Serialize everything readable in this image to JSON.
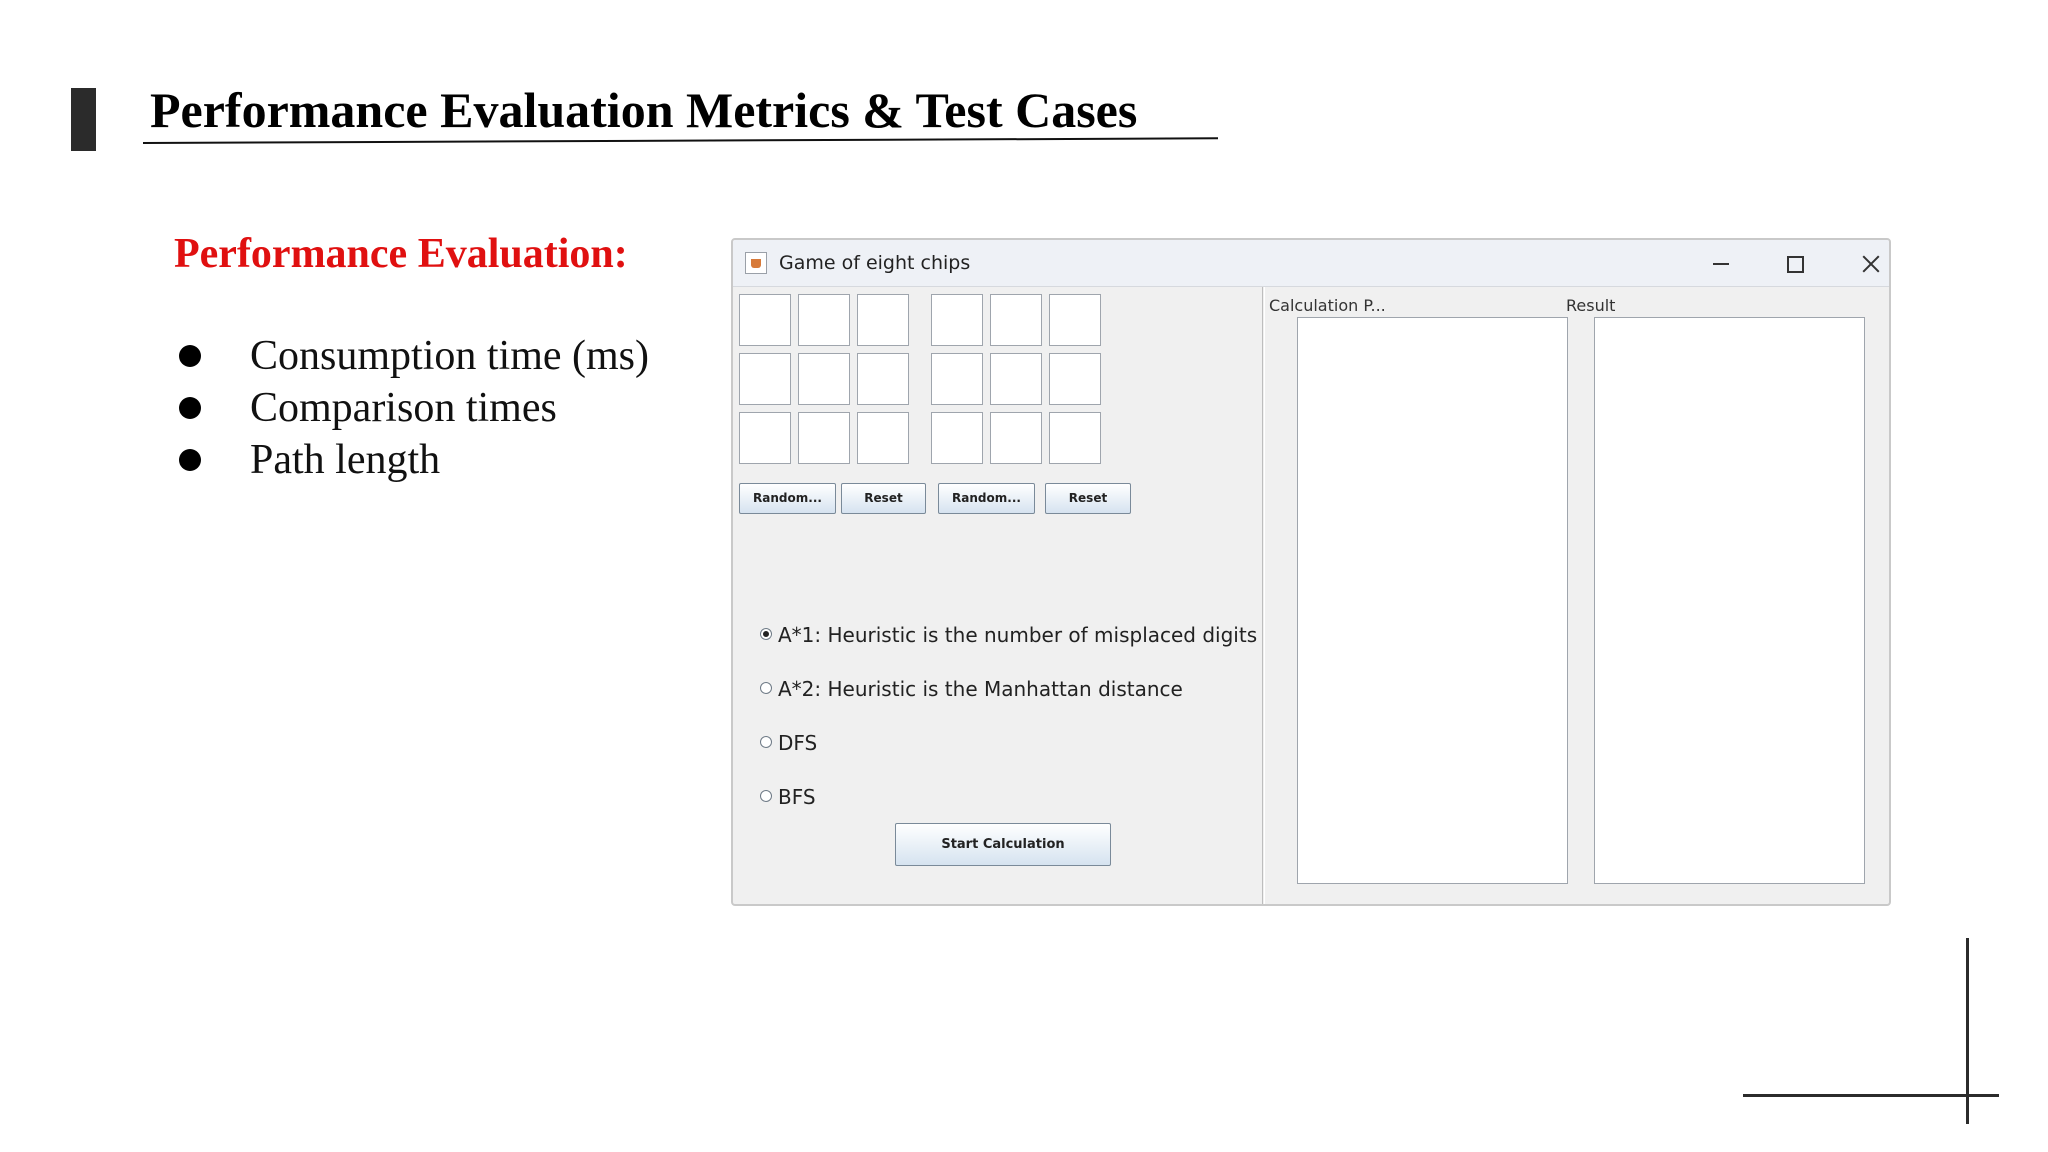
{
  "slide": {
    "title": "Performance Evaluation Metrics & Test Cases",
    "section_heading": "Performance Evaluation:",
    "metrics": [
      "Consumption time (ms)",
      "Comparison times",
      "Path length"
    ],
    "heading_color": "#e01010"
  },
  "window": {
    "title": "Game of eight chips",
    "app_icon": "java-app-icon",
    "controls": {
      "minimize_icon": "minimize-icon",
      "maximize_icon": "maximize-icon",
      "close_icon": "close-icon"
    },
    "left_grid": {
      "cells": [
        "",
        "",
        "",
        "",
        "",
        "",
        "",
        "",
        ""
      ]
    },
    "right_grid": {
      "cells": [
        "",
        "",
        "",
        "",
        "",
        "",
        "",
        "",
        ""
      ]
    },
    "buttons": {
      "random_1": "Random...",
      "reset_1": "Reset",
      "random_2": "Random...",
      "reset_2": "Reset",
      "start": "Start Calculation"
    },
    "algorithms": [
      {
        "label": "A*1: Heuristic is the number of misplaced digits",
        "selected": true
      },
      {
        "label": "A*2:  Heuristic is the Manhattan distance",
        "selected": false
      },
      {
        "label": "DFS",
        "selected": false
      },
      {
        "label": "BFS",
        "selected": false
      }
    ],
    "calculation_label": "Calculation P...",
    "result_label": "Result",
    "calculation_text": "",
    "result_text": ""
  }
}
